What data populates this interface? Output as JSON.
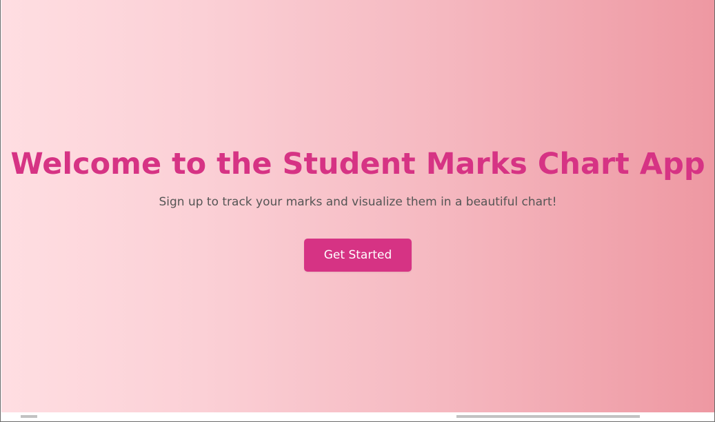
{
  "hero": {
    "title": "Welcome to the Student Marks Chart App",
    "subtitle": "Sign up to track your marks and visualize them in a beautiful chart!",
    "cta_label": "Get Started"
  },
  "colors": {
    "accent": "#d63384",
    "subtitle_text": "#555555",
    "gradient_start": "#ffdee2",
    "gradient_end": "#ee98a2"
  }
}
